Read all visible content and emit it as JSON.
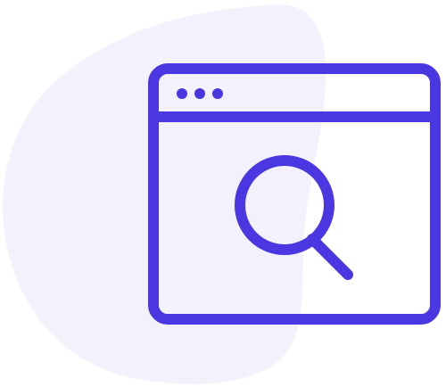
{
  "illustration": {
    "name": "browser-search-illustration",
    "icons": [
      "blob-background",
      "browser-window-icon",
      "search-icon"
    ],
    "colors": {
      "accent": "#4B37E1",
      "blob": "#F3F2FC",
      "background": "#FFFFFF"
    }
  }
}
